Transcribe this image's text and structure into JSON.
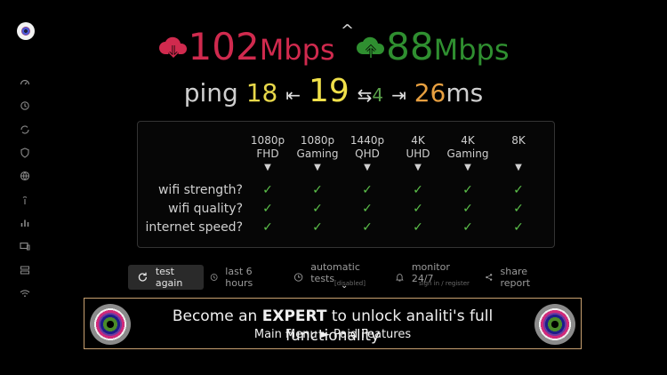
{
  "speeds": {
    "download": "102",
    "download_unit": "Mbps",
    "upload": "88",
    "upload_unit": "Mbps"
  },
  "ping": {
    "label": "ping",
    "min": "18",
    "avg": "19",
    "jitter": "4",
    "max": "26",
    "unit": "ms",
    "arrow_left": "⇤",
    "arrow_jitter": "⇆",
    "arrow_right": "⇥"
  },
  "table": {
    "columns": [
      {
        "line1": "1080p",
        "line2": "FHD"
      },
      {
        "line1": "1080p",
        "line2": "Gaming"
      },
      {
        "line1": "1440p",
        "line2": "QHD"
      },
      {
        "line1": "4K",
        "line2": "UHD"
      },
      {
        "line1": "4K",
        "line2": "Gaming"
      },
      {
        "line1": "8K",
        "line2": ""
      }
    ],
    "rows": [
      "wifi strength?",
      "wifi quality?",
      "internet speed?"
    ],
    "check_glyph": "✓",
    "col_arrow": "▼"
  },
  "actions": {
    "test_again": "test again",
    "last_hours": "last 6 hours",
    "automatic_tests": "automatic tests",
    "automatic_tests_sub": "[disabled]",
    "monitor": "monitor 24/7",
    "monitor_sub": "sign in / register",
    "share": "share report"
  },
  "banner": {
    "pre": "Become an ",
    "emph": "EXPERT",
    "post": " to unlock analiti's full functionality",
    "sub": "Main Menu ► Paid Features"
  },
  "colors": {
    "download": "#d02a4e",
    "upload": "#2f8f30",
    "ping_yellow": "#e8d84a",
    "check": "#5cc04a",
    "banner_border": "#c8a070"
  },
  "sidebar_icons": [
    "speedometer-icon",
    "history-icon",
    "sync-icon",
    "shield-icon",
    "globe-icon",
    "signal-tower-icon",
    "bar-chart-icon",
    "devices-icon",
    "grid-icon",
    "wifi-icon"
  ]
}
